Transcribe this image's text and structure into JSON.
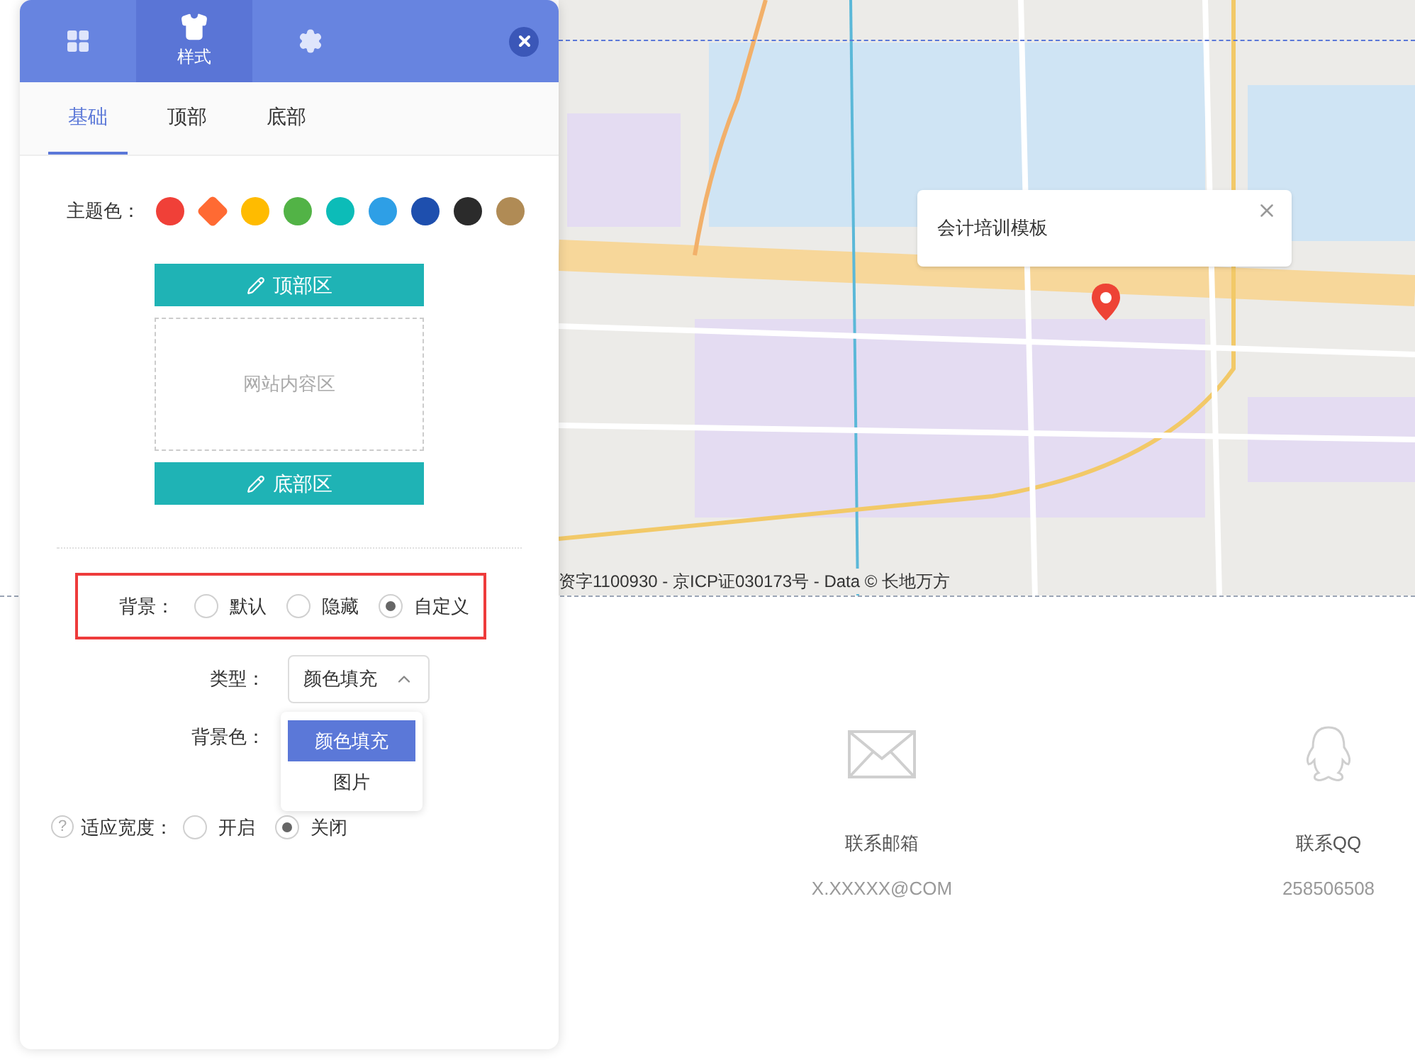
{
  "toolbar_tabs": [
    {
      "kind": "grid",
      "selected": false
    },
    {
      "kind": "shirt",
      "label": "样式",
      "selected": true
    },
    {
      "kind": "gear",
      "selected": false
    }
  ],
  "subtabs": [
    {
      "label": "基础",
      "selected": true
    },
    {
      "label": "顶部",
      "selected": false
    },
    {
      "label": "底部",
      "selected": false
    }
  ],
  "theme_color": {
    "label": "主题色：",
    "swatches": [
      {
        "color": "#f04038",
        "selected": false
      },
      {
        "color": "#ff6a33",
        "selected": true
      },
      {
        "color": "#ffbb00",
        "selected": false
      },
      {
        "color": "#52b346",
        "selected": false
      },
      {
        "color": "#0cbcb8",
        "selected": false
      },
      {
        "color": "#2e9fe6",
        "selected": false
      },
      {
        "color": "#1e4fae",
        "selected": false
      },
      {
        "color": "#2b2b2b",
        "selected": false
      },
      {
        "color": "#b08b55",
        "selected": false
      }
    ]
  },
  "layout_preview": {
    "header_button": "顶部区",
    "content_area": "网站内容区",
    "footer_button": "底部区"
  },
  "background": {
    "label": "背景：",
    "options": [
      {
        "label": "默认",
        "selected": false
      },
      {
        "label": "隐藏",
        "selected": false
      },
      {
        "label": "自定义",
        "selected": true
      }
    ]
  },
  "type_select": {
    "label": "类型：",
    "value": "颜色填充",
    "expanded": true,
    "options": [
      {
        "label": "颜色填充",
        "selected": true
      },
      {
        "label": "图片",
        "selected": false
      }
    ]
  },
  "background_color": {
    "label": "背景色："
  },
  "fit_width": {
    "help": "?",
    "label": "适应宽度：",
    "options": [
      {
        "label": "开启",
        "selected": false
      },
      {
        "label": "关闭",
        "selected": true
      }
    ]
  },
  "map": {
    "popup": "会计培训模板",
    "attribution": "资字1100930 - 京ICP证030173号 - Data © 长地万方"
  },
  "contacts": [
    {
      "kind": "email",
      "label": "联系邮箱",
      "value": "X.XXXXX@COM"
    },
    {
      "kind": "qq",
      "label": "联系QQ",
      "value": "258506508"
    }
  ]
}
